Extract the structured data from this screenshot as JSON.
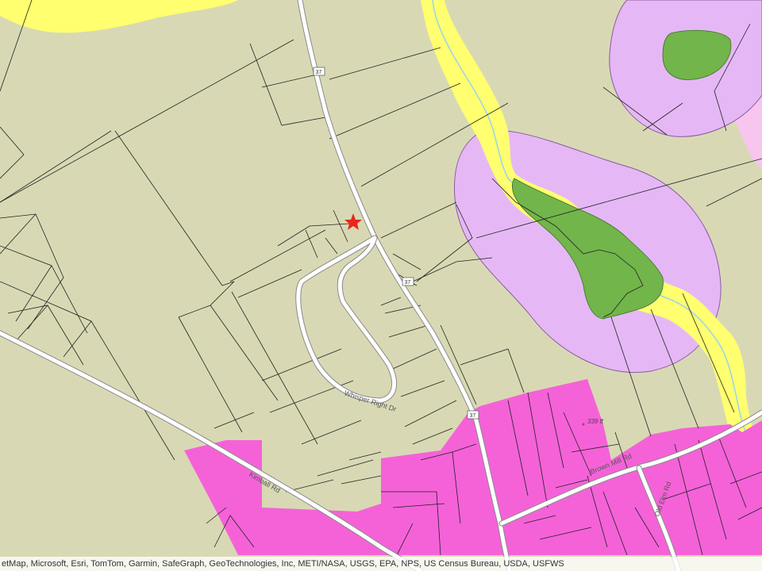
{
  "map": {
    "colors": {
      "background": "#d8d9b4",
      "flood_zone_yellow": "#ffff70",
      "wetland_buffer_lavender": "#e5b8f5",
      "wetland_green": "#72b54a",
      "commercial_magenta": "#f562d8",
      "light_pink": "#f7c5ee",
      "parcel_line": "#222222",
      "road_fill": "#ffffff",
      "road_edge": "#8a8a8a",
      "stream": "#9fd6e8",
      "marker": "#e8261c"
    },
    "road_labels": {
      "kimball": "Kimball Rd",
      "brown_mill": "Brown Mill Rd",
      "old_elm": "Old Elm Rd",
      "cul_de_sac": "Whisper Right Dr"
    },
    "route_shields": [
      "37",
      "37",
      "37"
    ],
    "elevation_label": "339 ft",
    "marker_icon": "red-star-icon",
    "attribution": "etMap, Microsoft, Esri, TomTom, Garmin, SafeGraph, GeoTechnologies, Inc, METI/NASA, USGS, EPA, NPS, US Census Bureau, USDA, USFWS"
  }
}
